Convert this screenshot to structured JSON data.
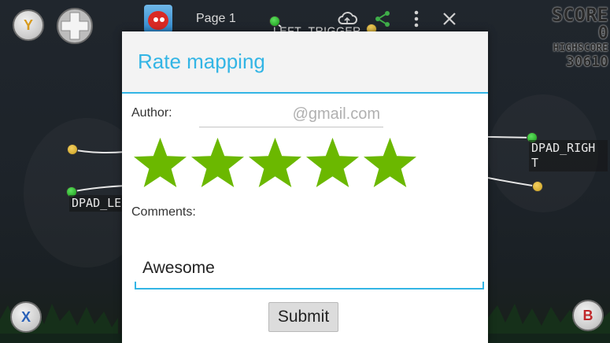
{
  "toolbar": {
    "page_label": "Page 1",
    "trigger_label": "LEFT_TRIGGER"
  },
  "controller": {
    "y_label": "Y",
    "x_label": "X",
    "b_label": "B"
  },
  "score": {
    "title": "SCORE",
    "value": "0",
    "highscore_title": "HIGHSCORE",
    "highscore_value": "30610"
  },
  "mappings": {
    "dpad_left": "DPAD_LE",
    "dpad_right": "DPAD_RIGH\nT"
  },
  "dialog": {
    "title": "Rate mapping",
    "author_label": "Author:",
    "author_placeholder": "@gmail.com",
    "rating": 5,
    "rating_max": 5,
    "comments_label": "Comments:",
    "comments_value": "Awesome",
    "submit_label": "Submit"
  },
  "colors": {
    "accent": "#33b5e5",
    "star": "#6bb800",
    "dialog_bg": "#ffffff"
  },
  "icons": [
    "y-button-icon",
    "dpad-icon",
    "app-icon",
    "cloud-icon",
    "share-icon",
    "menu-icon",
    "close-icon",
    "x-button-icon",
    "b-button-icon",
    "star-icon"
  ]
}
